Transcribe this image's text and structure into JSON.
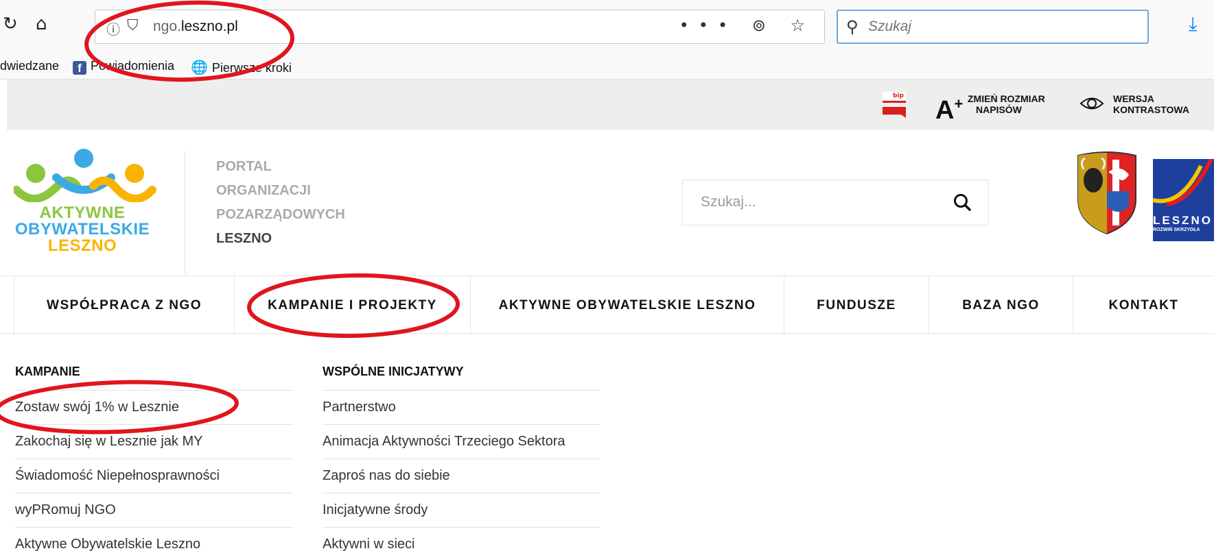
{
  "browser": {
    "url_prefix": "ngo.",
    "url_domain": "leszno.pl",
    "url_actions": "••• ⊚ ☆",
    "search_placeholder": "Szukaj",
    "bookmarks": [
      "dwiedzane",
      "Powiadomienia",
      "Pierwsze kroki"
    ]
  },
  "utility": {
    "font_size_label_1": "ZMIEŃ ROZMIAR",
    "font_size_label_2": "NAPISÓW",
    "contrast_label_1": "WERSJA",
    "contrast_label_2": "KONTRASTOWA"
  },
  "logo": {
    "line1": "AKTYWNE",
    "line2": "OBYWATELSKIE",
    "line3": "LESZNO"
  },
  "portal": {
    "line1": "PORTAL",
    "line2": "ORGANIZACJI",
    "line3": "POZARZĄDOWYCH",
    "line4": "LESZNO"
  },
  "site_search": {
    "placeholder": "Szukaj..."
  },
  "city_logo": {
    "name": "LESZNO",
    "tagline": "ROZWIŃ SKRZYDŁA"
  },
  "nav": [
    "WSPÓŁPRACA Z NGO",
    "KAMPANIE I PROJEKTY",
    "AKTYWNE OBYWATELSKIE LESZNO",
    "FUNDUSZE",
    "BAZA NGO",
    "KONTAKT"
  ],
  "dropdown": {
    "col1": {
      "heading": "KAMPANIE",
      "items": [
        "Zostaw swój 1% w Lesznie",
        "Zakochaj się w Lesznie jak MY",
        "Świadomość Niepełnosprawności",
        "wyPRomuj NGO",
        "Aktywne Obywatelskie Leszno"
      ]
    },
    "col2": {
      "heading": "WSPÓLNE INICJATYWY",
      "items": [
        "Partnerstwo",
        "Animacja Aktywności Trzeciego Sektora",
        "Zaproś nas do siebie",
        "Inicjatywne środy",
        "Aktywni w sieci"
      ]
    }
  },
  "colors": {
    "annotation": "#e0151d",
    "logo_green": "#8cc63f",
    "logo_blue": "#3ba9e6",
    "logo_yellow": "#f7b500",
    "firefox_blue": "#0a84ff"
  }
}
